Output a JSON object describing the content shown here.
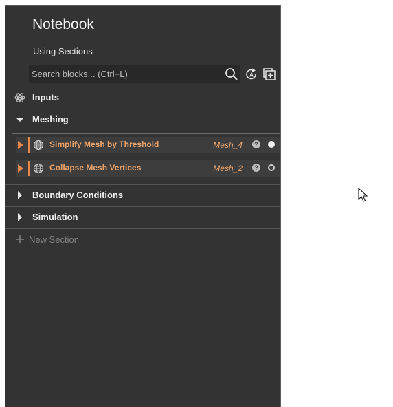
{
  "notebook": {
    "title": "Notebook",
    "subtitle": "Using Sections"
  },
  "search": {
    "placeholder": "Search blocks... (Ctrl+L)",
    "icon": "search-icon"
  },
  "toolbar": {
    "icons": [
      "auto-run-icon",
      "add-block-icon"
    ]
  },
  "sections": [
    {
      "label": "Inputs",
      "icon": "atom-icon",
      "state": "collapsed"
    },
    {
      "label": "Meshing",
      "icon": "triangle-down-icon",
      "state": "expanded",
      "blocks": [
        {
          "name": "Simplify Mesh by Threshold",
          "output": "Mesh_4",
          "status": "filled"
        },
        {
          "name": "Collapse Mesh Vertices",
          "output": "Mesh_2",
          "status": "empty"
        }
      ]
    },
    {
      "label": "Boundary Conditions",
      "icon": "triangle-right-icon",
      "state": "collapsed"
    },
    {
      "label": "Simulation",
      "icon": "triangle-right-icon",
      "state": "collapsed"
    }
  ],
  "new_section": {
    "label": "New Section"
  },
  "colors": {
    "panel_bg": "#333333",
    "accent": "#e8874a",
    "block_text": "#f0a56a"
  }
}
